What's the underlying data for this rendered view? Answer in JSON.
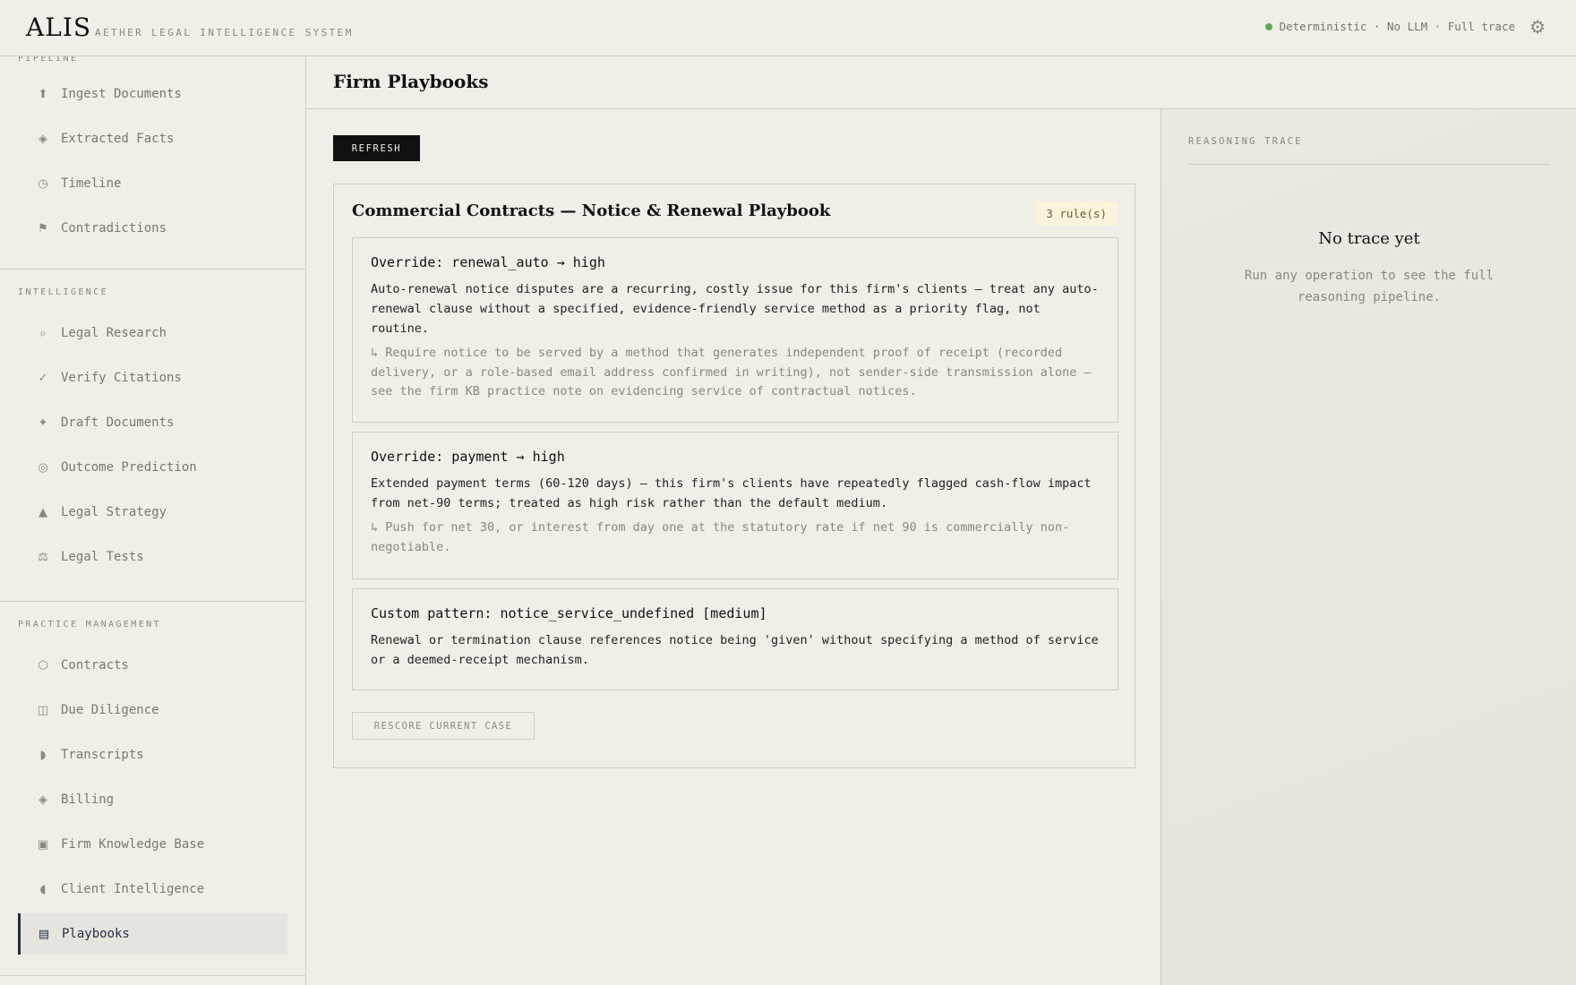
{
  "header": {
    "brand": "ALIS",
    "subtitle": "AETHER LEGAL INTELLIGENCE SYSTEM",
    "status_text": "Deterministic · No LLM · Full trace",
    "status_color": "#5aa85a",
    "settings_icon": "gear-icon",
    "settings_glyph": "⚙"
  },
  "sidebar": {
    "sections": [
      {
        "label": "PIPELINE",
        "items": [
          {
            "label": "Ingest Documents",
            "icon": "upload-icon",
            "glyph": "⬆"
          },
          {
            "label": "Extracted Facts",
            "icon": "diamond-icon",
            "glyph": "◈"
          },
          {
            "label": "Timeline",
            "icon": "clock-icon",
            "glyph": "◷"
          },
          {
            "label": "Contradictions",
            "icon": "flag-icon",
            "glyph": "⚑"
          }
        ]
      },
      {
        "label": "INTELLIGENCE",
        "items": [
          {
            "label": "Legal Research",
            "icon": "search-icon",
            "glyph": "⌕"
          },
          {
            "label": "Verify Citations",
            "icon": "check-icon",
            "glyph": "✓"
          },
          {
            "label": "Draft Documents",
            "icon": "sparkle-icon",
            "glyph": "✦"
          },
          {
            "label": "Outcome Prediction",
            "icon": "target-icon",
            "glyph": "◎"
          },
          {
            "label": "Legal Strategy",
            "icon": "triangle-icon",
            "glyph": "▲"
          },
          {
            "label": "Legal Tests",
            "icon": "scales-icon",
            "glyph": "⚖"
          }
        ]
      },
      {
        "label": "PRACTICE MANAGEMENT",
        "items": [
          {
            "label": "Contracts",
            "icon": "hexagon-icon",
            "glyph": "⬡"
          },
          {
            "label": "Due Diligence",
            "icon": "split-square-icon",
            "glyph": "◫"
          },
          {
            "label": "Transcripts",
            "icon": "half-circle-icon",
            "glyph": "◗"
          },
          {
            "label": "Billing",
            "icon": "diamond-icon",
            "glyph": "◈"
          },
          {
            "label": "Firm Knowledge Base",
            "icon": "filled-square-icon",
            "glyph": "▣"
          },
          {
            "label": "Client Intelligence",
            "icon": "half-circle-icon",
            "glyph": "◖"
          },
          {
            "label": "Playbooks",
            "icon": "list-icon",
            "glyph": "▤",
            "active": true
          }
        ]
      }
    ]
  },
  "main": {
    "title": "Firm Playbooks",
    "refresh_label": "REFRESH",
    "playbook": {
      "title": "Commercial Contracts — Notice & Renewal Playbook",
      "rule_count": "3 rule(s)",
      "rules": [
        {
          "title": "Override: renewal_auto → high",
          "body": "Auto-renewal notice disputes are a recurring, costly issue for this firm's clients — treat any auto-renewal clause without a specified, evidence-friendly service method as a priority flag, not routine.",
          "note": "↳ Require notice to be served by a method that generates independent proof of receipt (recorded delivery, or a role-based email address confirmed in writing), not sender-side transmission alone — see the firm KB practice note on evidencing service of contractual notices."
        },
        {
          "title": "Override: payment → high",
          "body": "Extended payment terms (60-120 days) — this firm's clients have repeatedly flagged cash-flow impact from net-90 terms; treated as high risk rather than the default medium.",
          "note": "↳ Push for net 30, or interest from day one at the statutory rate if net 90 is commercially non-negotiable."
        },
        {
          "title": "Custom pattern: notice_service_undefined [medium]",
          "body": "Renewal or termination clause references notice being 'given' without specifying a method of service or a deemed-receipt mechanism.",
          "note": ""
        }
      ],
      "rescore_label": "RESCORE CURRENT CASE"
    }
  },
  "trace": {
    "label": "REASONING TRACE",
    "empty_title": "No trace yet",
    "empty_body": "Run any operation to see the full reasoning pipeline."
  }
}
